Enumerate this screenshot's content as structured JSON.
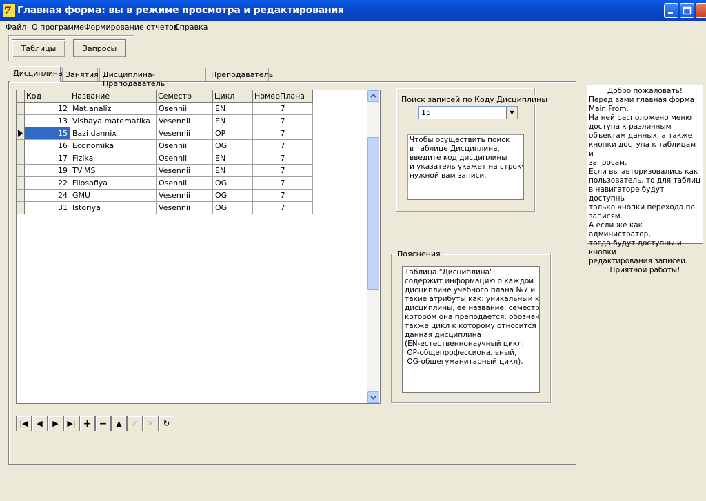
{
  "window": {
    "title": "Главная форма: вы в режиме просмотра и редактирования"
  },
  "menu": [
    "Файл",
    "О программе",
    "Формирование отчетов",
    "Справка"
  ],
  "toolbar": {
    "tables_label": "Таблицы",
    "queries_label": "Запросы"
  },
  "tabs": [
    "Дисциплина",
    "Занятия",
    "Дисциплина-Преподаватель",
    "Преподаватель"
  ],
  "grid": {
    "columns": [
      "Код",
      "Название",
      "Семестр",
      "Цикл",
      "НомерПлана"
    ],
    "rows": [
      [
        "12",
        "Mat.analiz",
        "Osennii",
        "EN",
        "7"
      ],
      [
        "13",
        "Vishaya matematika",
        "Vesennii",
        "EN",
        "7"
      ],
      [
        "15",
        "Bazi dannix",
        "Vesennii",
        "OP",
        "7"
      ],
      [
        "16",
        "Economika",
        "Osennii",
        "OG",
        "7"
      ],
      [
        "17",
        "Fizika",
        "Osennii",
        "EN",
        "7"
      ],
      [
        "19",
        "TViMS",
        "Vesennii",
        "EN",
        "7"
      ],
      [
        "22",
        "Filosofiya",
        "Osennii",
        "OG",
        "7"
      ],
      [
        "24",
        "GMU",
        "Vesennii",
        "OG",
        "7"
      ],
      [
        "31",
        "Istoriya",
        "Vesennii",
        "OG",
        "7"
      ]
    ],
    "selected_row": 2
  },
  "navigator": [
    "first",
    "prior",
    "next",
    "last",
    "insert",
    "delete",
    "edit",
    "post",
    "cancel",
    "refresh"
  ],
  "search": {
    "title": "Поиск записей по Коду Дисциплины",
    "value": "15",
    "hint": "Чтобы осуществить поиск\nв таблице Дисциплина,\nвведите код дисциплины\nи указатель укажет на строку\nнужной вам записи."
  },
  "explanations": {
    "title": "Пояснения",
    "text": "Таблица \"Дисциплина\":\nсодержит информацию о каждой\nдисциплине учебного плана №7 и\nтакие атрибуты как: уникальный код\nдисциплины, ее название, семестр в\nкотором она преподается, обозначен\nтакже цикл к которому относится\nданная дисциплина\n(EN-естественнонаучный цикл,\n OP-общепрофессиональный,\n OG-общегуманитарный цикл)."
  },
  "welcome": {
    "lines": [
      "Добро пожаловать!",
      "Перед вами главная форма",
      "Main From.",
      "На ней расположено меню",
      "доступа к различным",
      "объектам данных, а также",
      "кнопки доступа к таблицам и",
      "запросам.",
      "Если вы авторизовались как",
      "пользователь, то для таблиц",
      "в навигаторе будут доступны",
      "только кнопки перехода по",
      "записям.",
      "А если же как администратор,",
      "тогда будут доступны и кнопки",
      "редактирования записей.",
      "Приятной работы!"
    ]
  }
}
